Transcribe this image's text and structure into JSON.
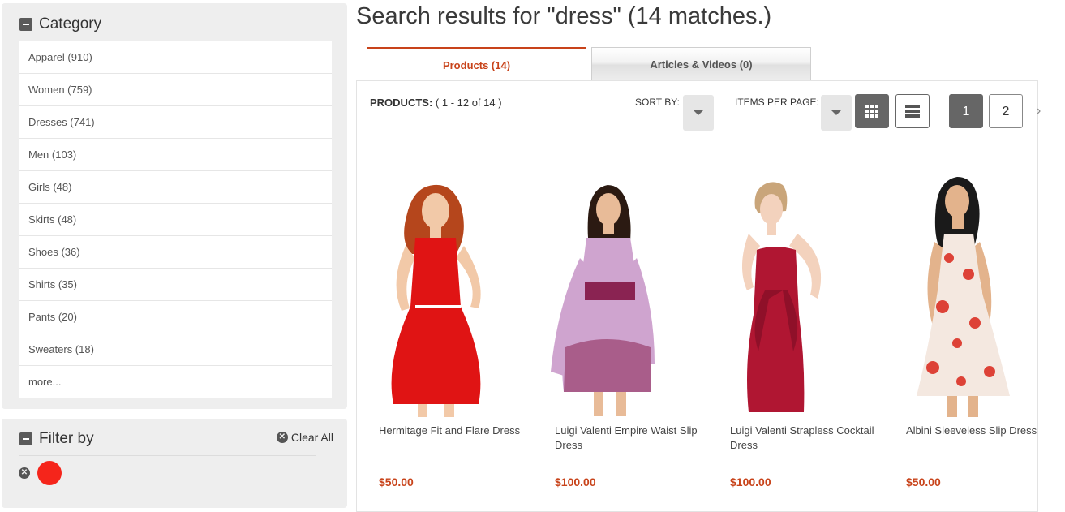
{
  "sidebar": {
    "category": {
      "title": "Category",
      "items": [
        "Apparel (910)",
        "Women (759)",
        "Dresses (741)",
        "Men (103)",
        "Girls (48)",
        "Skirts (48)",
        "Shoes (36)",
        "Shirts (35)",
        "Pants (20)",
        "Sweaters (18)",
        "more..."
      ]
    },
    "filter": {
      "title": "Filter by",
      "clear_all": "Clear All",
      "active_color": "#f5251b"
    }
  },
  "main": {
    "title": "Search results for \"dress\" (14 matches.)",
    "tabs": [
      {
        "label": "Products (14)",
        "active": true
      },
      {
        "label": "Articles & Videos (0)",
        "active": false
      }
    ],
    "toolbar": {
      "products_label": "PRODUCTS:",
      "range": "(  1 - 12 of 14  )",
      "sort_by": "SORT BY:",
      "items_per_page": "ITEMS PER PAGE:",
      "pages": [
        "1",
        "2"
      ],
      "current_page": "1"
    },
    "products": [
      {
        "name": "Hermitage Fit and Flare Dress",
        "price": "$50.00",
        "dress_color": "#e01414",
        "hair_color": "#b5461c"
      },
      {
        "name": "Luigi Valenti Empire Waist Slip Dress",
        "price": "$100.00",
        "dress_color": "#cfa4cf",
        "hair_color": "#2b1a12"
      },
      {
        "name": "Luigi Valenti Strapless Cocktail Dress",
        "price": "$100.00",
        "dress_color": "#b01632",
        "hair_color": "#c9a57a"
      },
      {
        "name": "Albini Sleeveless Slip Dress",
        "price": "$50.00",
        "dress_color": "#f4e8e0",
        "hair_color": "#1a1a1a"
      }
    ]
  },
  "colors": {
    "accent": "#c8431a"
  }
}
